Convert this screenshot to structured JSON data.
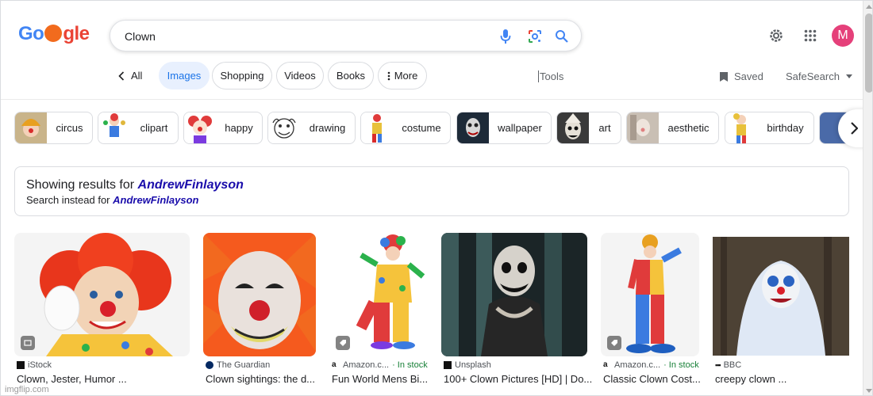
{
  "logo": {
    "text_left": "Go",
    "text_right": "gle"
  },
  "search": {
    "value": "Clown"
  },
  "account": {
    "initial": "M",
    "color": "#e5407a"
  },
  "tabs": {
    "all": "All",
    "items": [
      {
        "label": "Images",
        "active": true
      },
      {
        "label": "Shopping"
      },
      {
        "label": "Videos"
      },
      {
        "label": "Books"
      },
      {
        "label": "More"
      }
    ],
    "tools": "Tools",
    "saved": "Saved",
    "safesearch": "SafeSearch"
  },
  "chips": [
    {
      "label": "circus"
    },
    {
      "label": "clipart"
    },
    {
      "label": "happy"
    },
    {
      "label": "drawing"
    },
    {
      "label": "costume"
    },
    {
      "label": "wallpaper"
    },
    {
      "label": "art"
    },
    {
      "label": "aesthetic"
    },
    {
      "label": "birthday"
    }
  ],
  "spelling": {
    "showing_prefix": "Showing results for",
    "showing_term": "AndrewFinlayson",
    "instead_prefix": "Search instead for",
    "instead_term": "AndrewFinlayson"
  },
  "results": [
    {
      "source": "iStock",
      "stock": "",
      "title": "Clown, Jester, Humor ..."
    },
    {
      "source": "The Guardian",
      "stock": "",
      "title": "Clown sightings: the d..."
    },
    {
      "source": "Amazon.c...",
      "stock": "· In stock",
      "title": "Fun World Mens Bi..."
    },
    {
      "source": "Unsplash",
      "stock": "",
      "title": "100+ Clown Pictures [HD] | Do..."
    },
    {
      "source": "Amazon.c...",
      "stock": "· In stock",
      "title": "Classic Clown Cost..."
    },
    {
      "source": "BBC",
      "stock": "",
      "title": "creepy clown ..."
    }
  ],
  "watermark": "imgflip.com",
  "icons": [
    "mic-icon",
    "lens-icon",
    "search-icon",
    "settings-icon",
    "apps-icon",
    "chevron-left-icon",
    "dots-vertical-icon",
    "bookmark-icon",
    "caret-down-icon",
    "chevron-right-icon"
  ]
}
